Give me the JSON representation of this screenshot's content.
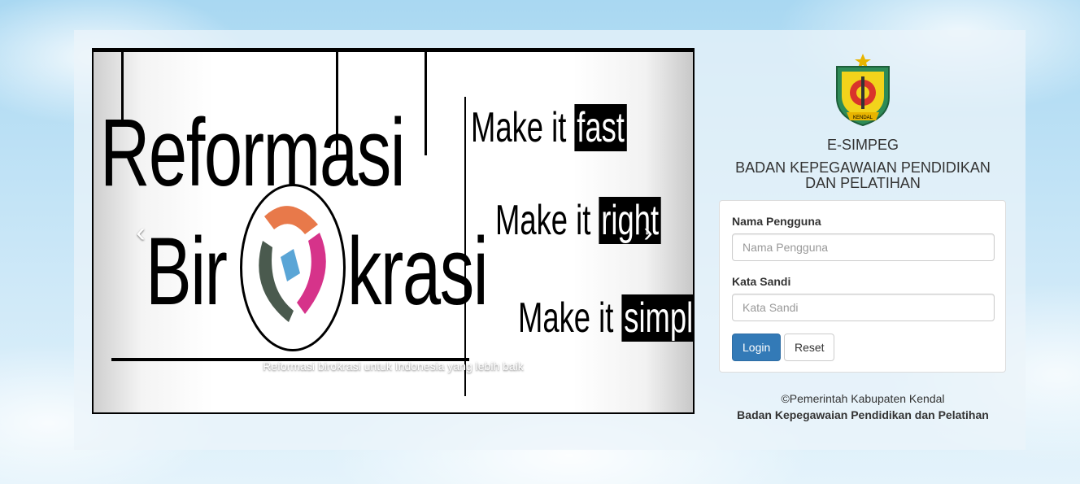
{
  "carousel": {
    "headline_line1": "Reformasi",
    "headline_line2_a": "Bir",
    "headline_line2_b": "krasi",
    "taglines": [
      {
        "prefix": "Make it",
        "highlight": "fast"
      },
      {
        "prefix": "Make it",
        "highlight": "right"
      },
      {
        "prefix": "Make it",
        "highlight": "simple"
      }
    ],
    "caption": "Reformasi birokrasi untuk Indonesia yang lebih baik",
    "prev_icon": "‹",
    "next_icon": "›"
  },
  "brand": {
    "emblem_text": "KENDAL",
    "app_title": "E-SIMPEG",
    "agency_line1": "BADAN KEPEGAWAIAN PENDIDIKAN",
    "agency_line2": "DAN PELATIHAN"
  },
  "login": {
    "username_label": "Nama Pengguna",
    "username_placeholder": "Nama Pengguna",
    "password_label": "Kata Sandi",
    "password_placeholder": "Kata Sandi",
    "login_button": "Login",
    "reset_button": "Reset"
  },
  "footer": {
    "copyright": "©Pemerintah Kabupaten Kendal",
    "agency": "Badan Kepegawaian Pendidikan dan Pelatihan"
  },
  "colors": {
    "primary": "#337ab7",
    "sky": "#a9d8f2"
  }
}
